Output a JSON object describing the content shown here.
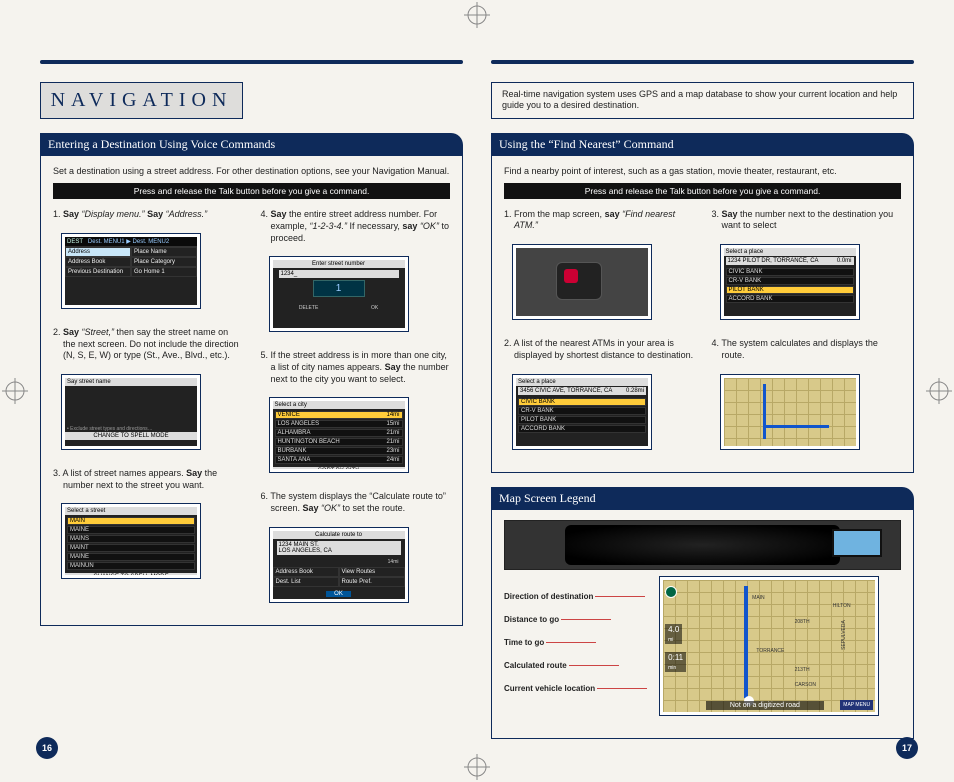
{
  "title": "NAVIGATION",
  "description": "Real-time navigation system uses GPS and a map database to show your current location and help guide you to a desired destination.",
  "page_left": "16",
  "page_right": "17",
  "section_a": {
    "heading": "Entering a Destination Using Voice Commands",
    "intro": "Set a destination using a street address. For other destination options, see your Navigation Manual.",
    "blackbar": "Press and release the Talk button before you give a command.",
    "steps": {
      "s1_a": "Say ",
      "s1_b": "“Display menu.” ",
      "s1_c": "Say ",
      "s1_d": "“Address.”",
      "s2_a": "Say ",
      "s2_b": "“Street,” ",
      "s2_c": "then say the street name on the next screen. Do not include the direction (N, S, E, W) or type (St., Ave., Blvd., etc.).",
      "s3_a": "A list of street names appears. ",
      "s3_b": "Say ",
      "s3_c": "the number next to the street you want.",
      "s4_a": "Say ",
      "s4_b": "the entire street address number. For example, ",
      "s4_c": "“1-2-3-4.” ",
      "s4_d": "If necessary, ",
      "s4_e": "say ",
      "s4_f": "“OK” ",
      "s4_g": "to proceed.",
      "s5_a": "If the street address is in more than one city,  a list of city names appears. ",
      "s5_b": "Say ",
      "s5_c": "the number next to the city you want to select.",
      "s6_a": "The system displays the “Calculate route to” screen. ",
      "s6_b": "Say ",
      "s6_c": "“OK” ",
      "s6_d": "to set the route."
    },
    "mini": {
      "dest_header": "DEST",
      "dest_menu12": "Dest. MENU1 ▶ Dest. MENU2",
      "address": "Address",
      "placename": "Place Name",
      "addrbook": "Address Book",
      "placecat": "Place Category",
      "prevdest": "Previous Destination",
      "gohome": "Go Home 1",
      "enter_sn": "Enter street number",
      "num": "1234_",
      "delete": "DELETE",
      "ok": "OK",
      "say_street": "Say street name",
      "hint": "• Exclude street types and directions…",
      "spell": "CHANGE TO SPELL MODE",
      "sel_city": "Select a city",
      "venice": "VENICE",
      "la": "LOS ANGELES",
      "alh": "ALHAMBRA",
      "hb": "HUNTINGTON BEACH",
      "bur": "BURBANK",
      "sa": "SANTA ANA",
      "sortcity": "SORT BY CITY",
      "d14": "14mi",
      "d15": "15mi",
      "d21": "21mi",
      "d23": "23mi",
      "d24": "24mi",
      "sel_street": "Select a street",
      "main": "MAIN",
      "maine": "MAINE",
      "mains": "MAINS",
      "maint": "MAINT",
      "mainun": "MAINUN",
      "calc": "Calculate route to",
      "addr": "1234 MAIN ST.\nLOS ANGELES, CA",
      "addrbook2": "Address Book",
      "destlist": "Dest. List",
      "viewroutes": "View Routes",
      "routepref": "Route Pref."
    }
  },
  "section_b": {
    "heading": "Using the “Find Nearest” Command",
    "intro": "Find a nearby point of interest, such as a gas station, movie theater, restaurant, etc.",
    "blackbar": "Press and release the Talk button before you give a command.",
    "steps": {
      "s1_a": "From the map screen, ",
      "s1_b": "say ",
      "s1_c": "“Find nearest ATM.”",
      "s2": "A list of the nearest ATMs in your area is displayed by shortest distance to destination.",
      "s3_a": "Say ",
      "s3_b": "the number next to the destination you want to select",
      "s4": "The system calculates and displays the route."
    },
    "mini": {
      "sel_place": "Select a place",
      "addr1": "3456 CIVIC AVE, TORRANCE, CA",
      "dist28": "0.28mi",
      "civic": "CIVIC BANK",
      "crv": "CR-V BANK",
      "pilot": "PILOT BANK",
      "accord": "ACCORD BANK",
      "addr2": "1234 PILOT DR, TORRANCE, CA",
      "dist0": "0.0mi"
    }
  },
  "section_c": {
    "heading": "Map Screen Legend",
    "labels": {
      "l1": "Direction of destination",
      "l2": "Distance to go",
      "l3": "Time to go",
      "l4": "Calculated route",
      "l5": "Current vehicle location"
    },
    "map_text": "Not on a digitized road",
    "map_menu": "MAP MENU",
    "map_labels": {
      "a": "4.0",
      "b": "mi",
      "c": "0:11",
      "d": "min",
      "e": "MAIN",
      "f": "208TH",
      "g": "TORRANCE",
      "h": "213TH",
      "i": "CARSON",
      "j": "HILTON",
      "k": "SEPULVEDA"
    }
  }
}
